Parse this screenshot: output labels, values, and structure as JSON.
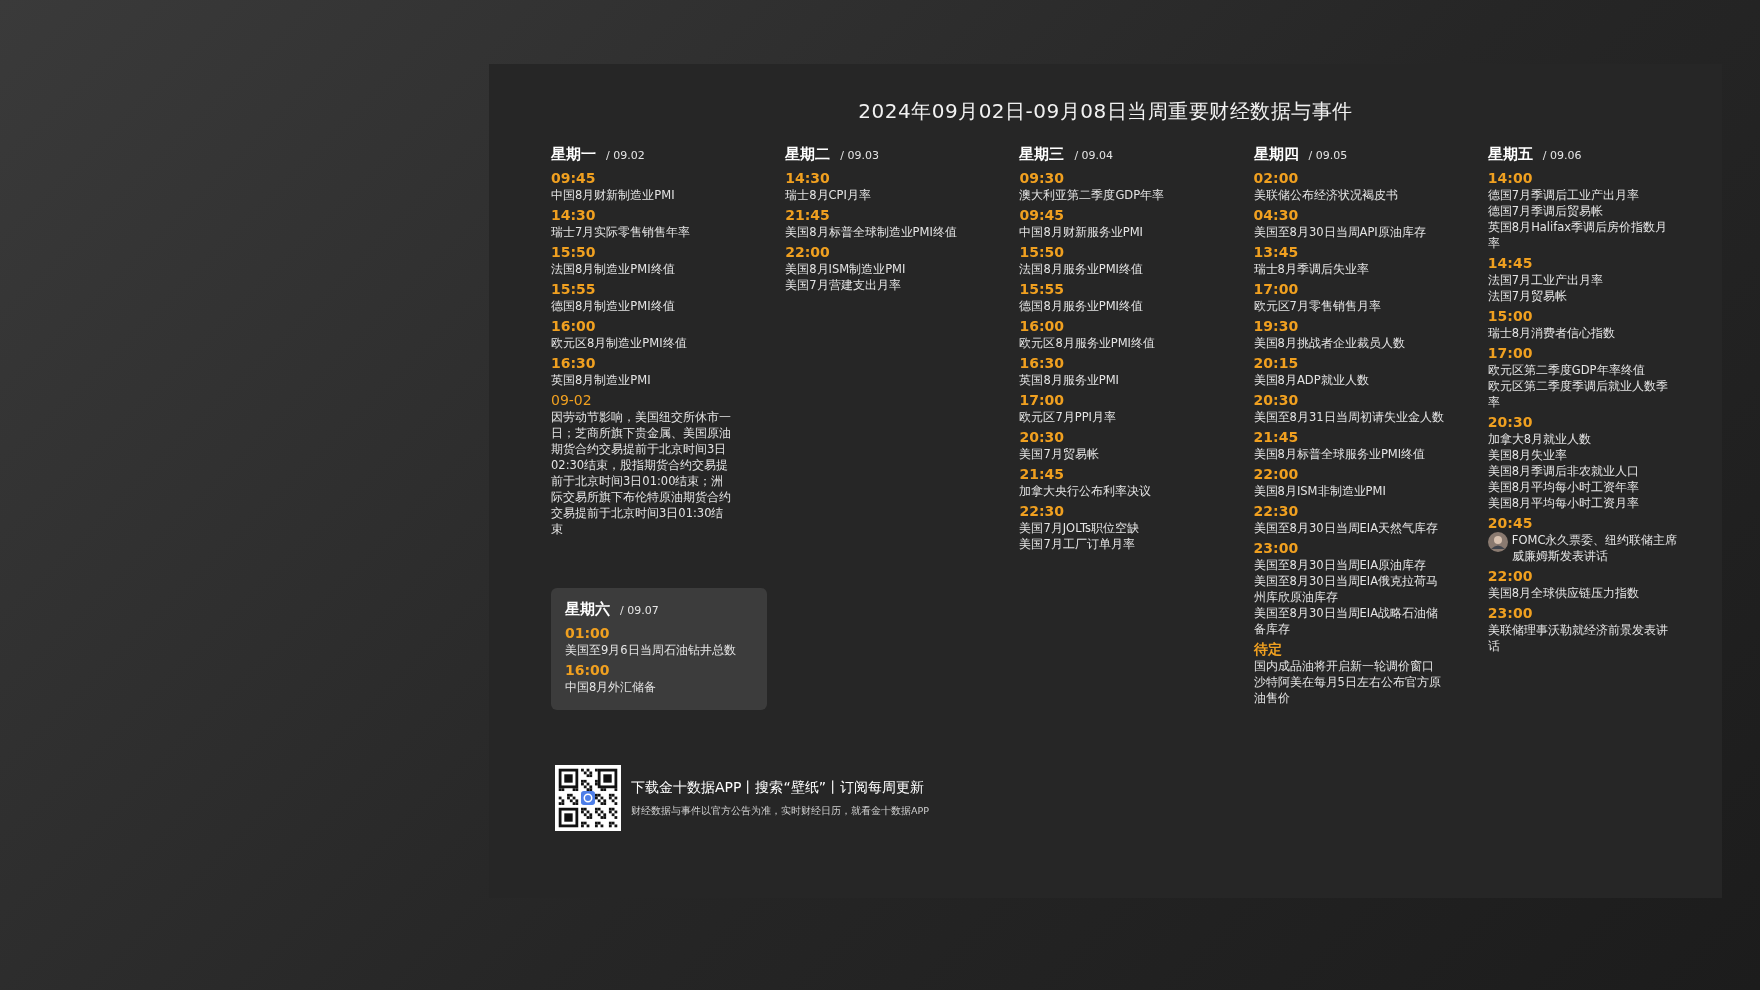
{
  "title": "2024年09月02日-09月08日当周重要财经数据与事件",
  "days": [
    {
      "name": "星期一",
      "date": "/ 09.02",
      "events": [
        {
          "kind": "list",
          "time": "09:45",
          "items": [
            "中国8月财新制造业PMI"
          ]
        },
        {
          "kind": "list",
          "time": "14:30",
          "items": [
            "瑞士7月实际零售销售年率"
          ]
        },
        {
          "kind": "list",
          "time": "15:50",
          "items": [
            "法国8月制造业PMI终值"
          ]
        },
        {
          "kind": "list",
          "time": "15:55",
          "items": [
            "德国8月制造业PMI终值"
          ]
        },
        {
          "kind": "list",
          "time": "16:00",
          "items": [
            "欧元区8月制造业PMI终值"
          ]
        },
        {
          "kind": "list",
          "time": "16:30",
          "items": [
            "英国8月制造业PMI"
          ]
        },
        {
          "kind": "note",
          "time": "09-02",
          "items": [
            "因劳动节影响，美国纽交所休市一日；芝商所旗下贵金属、美国原油期货合约交易提前于北京时间3日02:30结束，股指期货合约交易提前于北京时间3日01:00结束；洲际交易所旗下布伦特原油期货合约交易提前于北京时间3日01:30结束"
          ]
        }
      ]
    },
    {
      "name": "星期二",
      "date": "/ 09.03",
      "events": [
        {
          "kind": "list",
          "time": "14:30",
          "items": [
            "瑞士8月CPI月率"
          ]
        },
        {
          "kind": "list",
          "time": "21:45",
          "items": [
            "美国8月标普全球制造业PMI终值"
          ]
        },
        {
          "kind": "list",
          "time": "22:00",
          "items": [
            "美国8月ISM制造业PMI",
            "美国7月营建支出月率"
          ]
        }
      ]
    },
    {
      "name": "星期三",
      "date": "/ 09.04",
      "events": [
        {
          "kind": "list",
          "time": "09:30",
          "items": [
            "澳大利亚第二季度GDP年率"
          ]
        },
        {
          "kind": "list",
          "time": "09:45",
          "items": [
            "中国8月财新服务业PMI"
          ]
        },
        {
          "kind": "list",
          "time": "15:50",
          "items": [
            "法国8月服务业PMI终值"
          ]
        },
        {
          "kind": "list",
          "time": "15:55",
          "items": [
            "德国8月服务业PMI终值"
          ]
        },
        {
          "kind": "list",
          "time": "16:00",
          "items": [
            "欧元区8月服务业PMI终值"
          ]
        },
        {
          "kind": "list",
          "time": "16:30",
          "items": [
            "英国8月服务业PMI"
          ]
        },
        {
          "kind": "list",
          "time": "17:00",
          "items": [
            "欧元区7月PPI月率"
          ]
        },
        {
          "kind": "list",
          "time": "20:30",
          "items": [
            "美国7月贸易帐"
          ]
        },
        {
          "kind": "list",
          "time": "21:45",
          "items": [
            "加拿大央行公布利率决议"
          ]
        },
        {
          "kind": "list",
          "time": "22:30",
          "items": [
            "美国7月JOLTs职位空缺",
            "美国7月工厂订单月率"
          ]
        }
      ]
    },
    {
      "name": "星期四",
      "date": "/ 09.05",
      "events": [
        {
          "kind": "list",
          "time": "02:00",
          "items": [
            "美联储公布经济状况褐皮书"
          ]
        },
        {
          "kind": "list",
          "time": "04:30",
          "items": [
            "美国至8月30日当周API原油库存"
          ]
        },
        {
          "kind": "list",
          "time": "13:45",
          "items": [
            "瑞士8月季调后失业率"
          ]
        },
        {
          "kind": "list",
          "time": "17:00",
          "items": [
            "欧元区7月零售销售月率"
          ]
        },
        {
          "kind": "list",
          "time": "19:30",
          "items": [
            "美国8月挑战者企业裁员人数"
          ]
        },
        {
          "kind": "list",
          "time": "20:15",
          "items": [
            "美国8月ADP就业人数"
          ]
        },
        {
          "kind": "list",
          "time": "20:30",
          "items": [
            "美国至8月31日当周初请失业金人数"
          ]
        },
        {
          "kind": "list",
          "time": "21:45",
          "items": [
            "美国8月标普全球服务业PMI终值"
          ]
        },
        {
          "kind": "list",
          "time": "22:00",
          "items": [
            "美国8月ISM非制造业PMI"
          ]
        },
        {
          "kind": "list",
          "time": "22:30",
          "items": [
            "美国至8月30日当周EIA天然气库存"
          ]
        },
        {
          "kind": "list",
          "time": "23:00",
          "items": [
            "美国至8月30日当周EIA原油库存",
            "美国至8月30日当周EIA俄克拉荷马州库欣原油库存",
            "美国至8月30日当周EIA战略石油储备库存"
          ]
        },
        {
          "kind": "list",
          "time": "待定",
          "items": [
            "国内成品油将开启新一轮调价窗口",
            "沙特阿美在每月5日左右公布官方原油售价"
          ]
        }
      ]
    },
    {
      "name": "星期五",
      "date": "/ 09.06",
      "events": [
        {
          "kind": "list",
          "time": "14:00",
          "items": [
            "德国7月季调后工业产出月率",
            "德国7月季调后贸易帐",
            "英国8月Halifax季调后房价指数月率"
          ]
        },
        {
          "kind": "list",
          "time": "14:45",
          "items": [
            "法国7月工业产出月率",
            "法国7月贸易帐"
          ]
        },
        {
          "kind": "list",
          "time": "15:00",
          "items": [
            "瑞士8月消费者信心指数"
          ]
        },
        {
          "kind": "list",
          "time": "17:00",
          "items": [
            "欧元区第二季度GDP年率终值",
            "欧元区第二季度季调后就业人数季率"
          ]
        },
        {
          "kind": "list",
          "time": "20:30",
          "items": [
            "加拿大8月就业人数",
            "美国8月失业率",
            "美国8月季调后非农就业人口",
            "美国8月平均每小时工资年率",
            "美国8月平均每小时工资月率"
          ]
        },
        {
          "kind": "speaker",
          "time": "20:45",
          "items": [
            "FOMC永久票委、纽约联储主席威廉姆斯发表讲话"
          ]
        },
        {
          "kind": "list",
          "time": "22:00",
          "items": [
            "美国8月全球供应链压力指数"
          ]
        },
        {
          "kind": "list",
          "time": "23:00",
          "items": [
            "美联储理事沃勒就经济前景发表讲话"
          ]
        }
      ]
    }
  ],
  "weekend": {
    "name": "星期六",
    "date": "/ 09.07",
    "events": [
      {
        "kind": "list",
        "time": "01:00",
        "items": [
          "美国至9月6日当周石油钻井总数"
        ]
      },
      {
        "kind": "list",
        "time": "16:00",
        "items": [
          "中国8月外汇储备"
        ]
      }
    ]
  },
  "footer": {
    "headline": "下载金十数据APP丨搜索“壁纸”丨订阅每周更新",
    "note": "财经数据与事件以官方公告为准，实时财经日历，就看金十数据APP"
  }
}
